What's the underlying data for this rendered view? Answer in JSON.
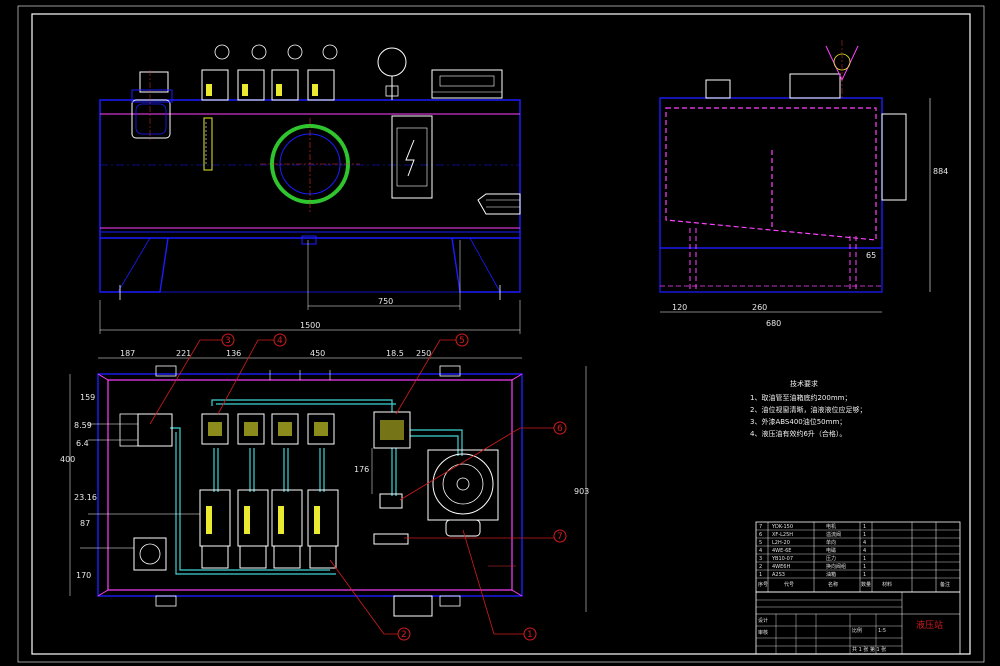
{
  "colors": {
    "background": "#000000",
    "frame": "#ffffff",
    "outline": "#1c1cff",
    "inner": "#ff40ff",
    "pipe": "#3fd3d3",
    "center": "#e03030",
    "hatch": "#eaea30",
    "leader": "#d21c1c",
    "ring": "#2ec52e"
  },
  "front_view": {
    "dims": {
      "bottom_width": "1500",
      "inner_span": "750"
    }
  },
  "side_view": {
    "dims": {
      "height": "884",
      "base_left": "120",
      "base_mid": "260",
      "base_total": "680",
      "foot": "65"
    }
  },
  "plan_view": {
    "top_dims": [
      "187",
      "221",
      "136",
      "450",
      "18.5",
      "250"
    ],
    "left_dims": [
      "159",
      "8.59",
      "6.4",
      "400",
      "23.16",
      "87",
      "170"
    ],
    "mid_dims": {
      "v176": "176",
      "right_height": "903"
    }
  },
  "balloons": [
    "1",
    "2",
    "3",
    "4",
    "5",
    "6",
    "7"
  ],
  "notes": {
    "title": "技术要求",
    "items": [
      "1、取油管至油箱底约200mm；",
      "2、油位视窗清晰，油液液位应足够；",
      "3、外漆ABS400油位50mm；",
      "4、液压油有效约6升（合格）。"
    ]
  },
  "parts_table": {
    "rows": [
      {
        "no": "7",
        "code": "YDK-150",
        "name": "电机",
        "qty": "1"
      },
      {
        "no": "6",
        "code": "XF-L25H",
        "name": "溢流阀",
        "qty": "1"
      },
      {
        "no": "5",
        "code": "L2H-20",
        "name": "单向",
        "qty": "4"
      },
      {
        "no": "4",
        "code": "4WE-6E",
        "name": "电磁",
        "qty": "4"
      },
      {
        "no": "3",
        "code": "YB10-07",
        "name": "压力",
        "qty": "1"
      },
      {
        "no": "2",
        "code": "4WE6H",
        "name": "换向阀组",
        "qty": "1"
      },
      {
        "no": "1",
        "code": "A2S3",
        "name": "油箱",
        "qty": "1"
      }
    ],
    "header": {
      "no": "序号",
      "code": "代号",
      "name": "名称",
      "qty": "数量",
      "material": "材料",
      "remark": "备注"
    }
  },
  "title_block": {
    "drawing_title": "液压站",
    "scale_label": "比例",
    "scale": "1:5",
    "sheet": "共 1 张 第 1 张",
    "designer": "设计",
    "checker": "审核"
  }
}
